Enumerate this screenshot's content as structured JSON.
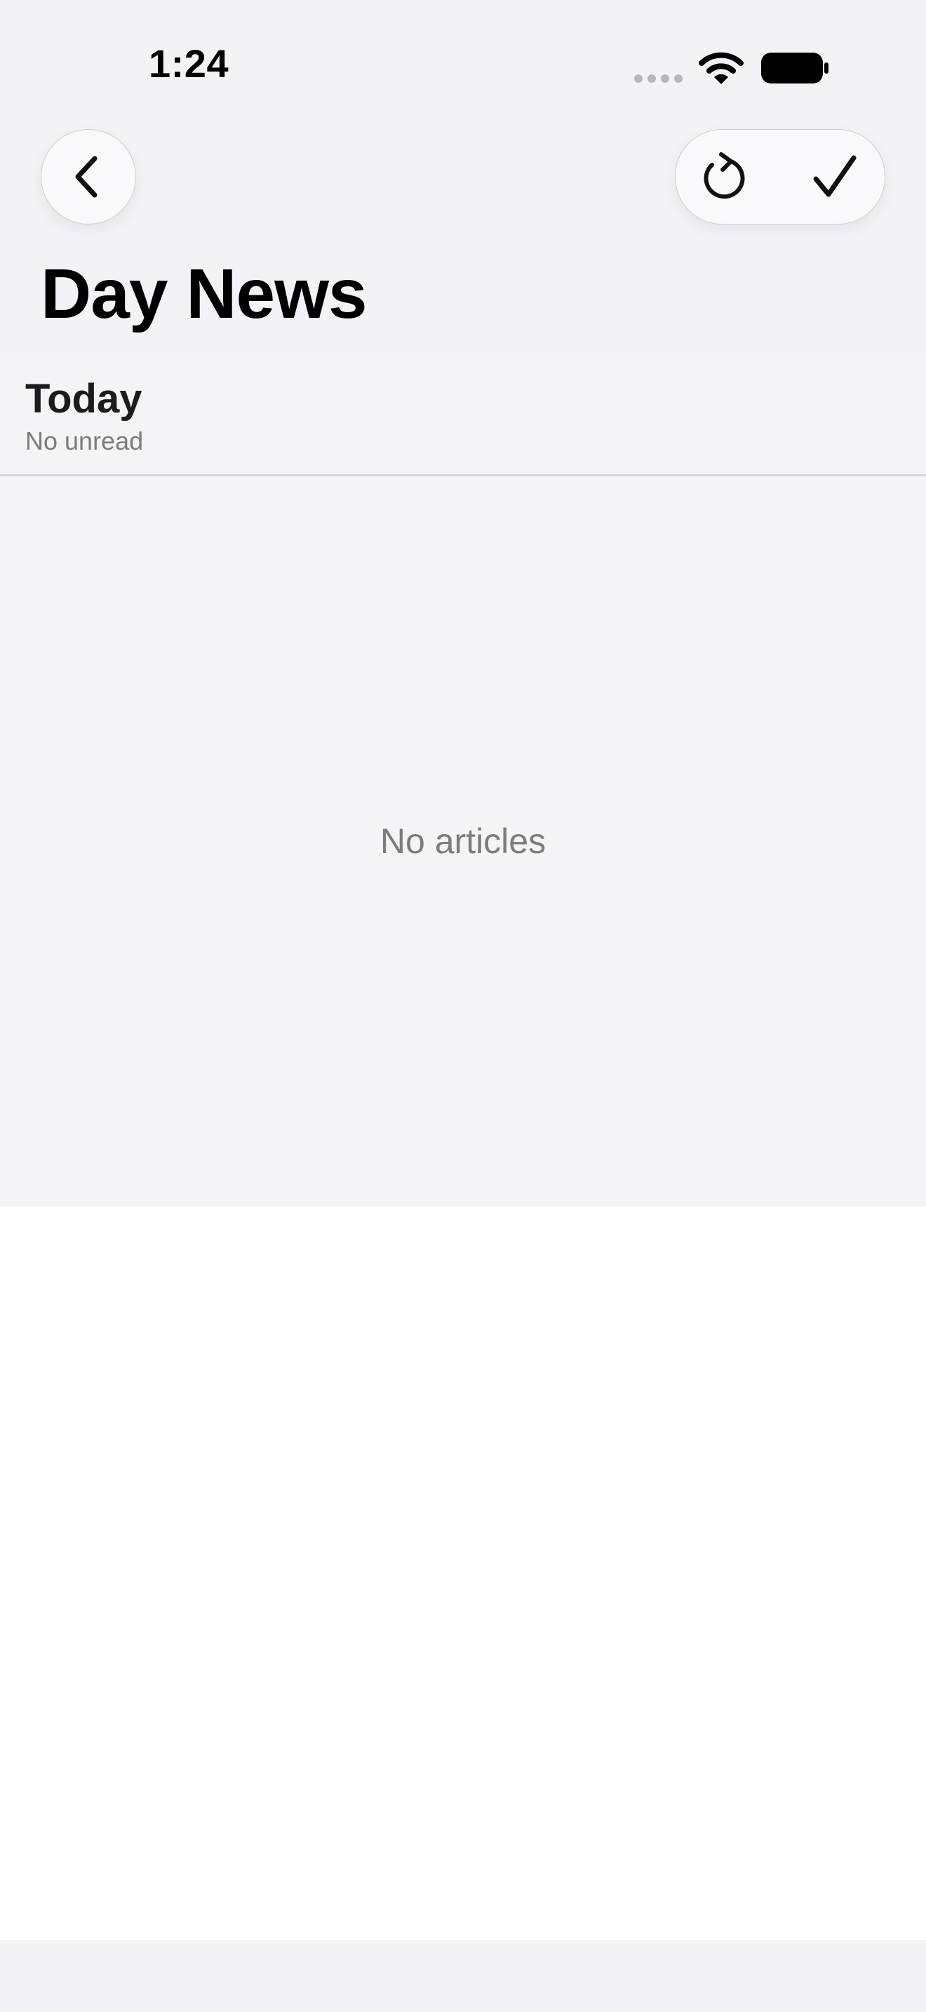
{
  "status_bar": {
    "time": "1:24",
    "icons": [
      "cellular-signal-icon",
      "wifi-icon",
      "battery-icon"
    ]
  },
  "nav": {
    "back_icon": "chevron-left-icon",
    "actions": [
      "refresh-icon",
      "checkmark-icon"
    ]
  },
  "page": {
    "title": "Day News"
  },
  "section": {
    "title": "Today",
    "subtitle": "No unread"
  },
  "empty_state": {
    "message": "No articles"
  },
  "colors": {
    "background": "#f2f2f7",
    "panel": "#f4f4f7",
    "secondary_text": "#7c7c80"
  }
}
